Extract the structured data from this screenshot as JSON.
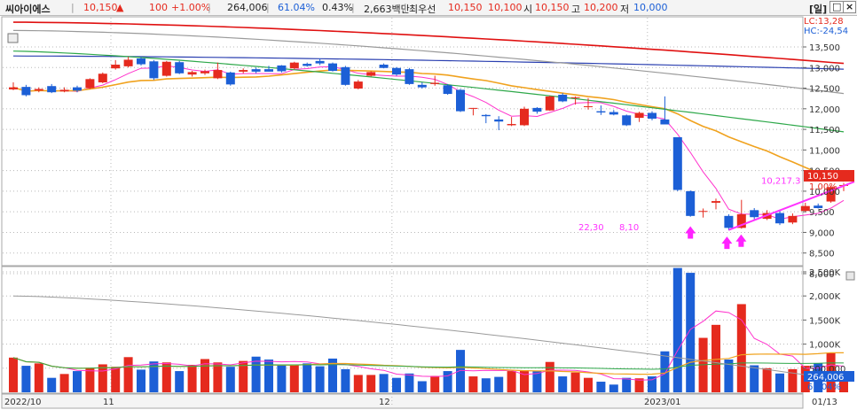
{
  "header": {
    "name": "씨아이에스",
    "price": "10,150",
    "up_mark": "▲",
    "change": "100",
    "change_pct": "+1.00%",
    "volume": "264,006",
    "vol_ratio": "61.04%",
    "turnover": "0.43%",
    "amount": "2,663백만",
    "best_label": "최우선",
    "ask": "10,150",
    "bid": "10,100",
    "open_label": "시",
    "open": "10,150",
    "high_label": "고",
    "high": "10,200",
    "low_label": "저",
    "low": "10,000",
    "period": "[일]",
    "btn_restore": "□",
    "btn_close": "×"
  },
  "colors": {
    "up": "#e52a1e",
    "down": "#1c5fd6",
    "ma5": "#ff33cc",
    "ma20": "#f0a21e",
    "ma60": "#2ea84a",
    "ma120": "#9a9a9a",
    "ma200": "#2a3fb0",
    "ma_red": "#e01010",
    "grid": "#b8b8b8",
    "trend": "#ff33ff"
  },
  "chart_data": {
    "type": "candlestick",
    "price_labels": [
      "13,500",
      "13,000",
      "12,500",
      "12,000",
      "11,500",
      "11,000",
      "10,500",
      "10,000",
      "9,500",
      "9,000",
      "8,500",
      "8,000"
    ],
    "volume_labels": [
      "2,500K",
      "2,000K",
      "1,500K",
      "1,000K",
      "500,000"
    ],
    "x_labels": [
      "2022/10",
      "11",
      "12",
      "2023/01",
      "01/13"
    ],
    "lc_label": "LC:13,28",
    "hc_label": "HC:-24,54",
    "last_price": "10,150",
    "last_change": "1.00%",
    "last_volume": "264,006",
    "last_vol_ratio": "61.04%",
    "trend_label": "10,217.3",
    "low_label_1": "22,30",
    "low_label_2": "8,10",
    "candles": [
      {
        "o": 12470,
        "c": 12520,
        "h": 12640,
        "l": 12450,
        "v": 720000
      },
      {
        "o": 12530,
        "c": 12330,
        "h": 12580,
        "l": 12300,
        "v": 550000
      },
      {
        "o": 12440,
        "c": 12480,
        "h": 12520,
        "l": 12400,
        "v": 600000
      },
      {
        "o": 12550,
        "c": 12400,
        "h": 12600,
        "l": 12380,
        "v": 300000
      },
      {
        "o": 12420,
        "c": 12460,
        "h": 12520,
        "l": 12400,
        "v": 380000
      },
      {
        "o": 12520,
        "c": 12440,
        "h": 12560,
        "l": 12400,
        "v": 440000
      },
      {
        "o": 12500,
        "c": 12720,
        "h": 12740,
        "l": 12480,
        "v": 510000
      },
      {
        "o": 12640,
        "c": 12850,
        "h": 12880,
        "l": 12620,
        "v": 580000
      },
      {
        "o": 12980,
        "c": 13070,
        "h": 13180,
        "l": 12950,
        "v": 530000
      },
      {
        "o": 13030,
        "c": 13190,
        "h": 13260,
        "l": 13000,
        "v": 730000
      },
      {
        "o": 13220,
        "c": 13080,
        "h": 13260,
        "l": 13050,
        "v": 470000
      },
      {
        "o": 13150,
        "c": 12740,
        "h": 13180,
        "l": 12700,
        "v": 640000
      },
      {
        "o": 12800,
        "c": 13140,
        "h": 13160,
        "l": 12780,
        "v": 620000
      },
      {
        "o": 13130,
        "c": 12860,
        "h": 13160,
        "l": 12840,
        "v": 440000
      },
      {
        "o": 12830,
        "c": 12890,
        "h": 12920,
        "l": 12780,
        "v": 570000
      },
      {
        "o": 12860,
        "c": 12910,
        "h": 12950,
        "l": 12820,
        "v": 690000
      },
      {
        "o": 12740,
        "c": 12940,
        "h": 13120,
        "l": 12720,
        "v": 620000
      },
      {
        "o": 12880,
        "c": 12590,
        "h": 12900,
        "l": 12560,
        "v": 530000
      },
      {
        "o": 12900,
        "c": 12940,
        "h": 12980,
        "l": 12860,
        "v": 650000
      },
      {
        "o": 12960,
        "c": 12900,
        "h": 13000,
        "l": 12860,
        "v": 740000
      },
      {
        "o": 12960,
        "c": 12900,
        "h": 13040,
        "l": 12900,
        "v": 680000
      },
      {
        "o": 13050,
        "c": 12910,
        "h": 13060,
        "l": 12880,
        "v": 560000
      },
      {
        "o": 12980,
        "c": 13120,
        "h": 13140,
        "l": 12960,
        "v": 570000
      },
      {
        "o": 13090,
        "c": 13040,
        "h": 13120,
        "l": 13020,
        "v": 600000
      },
      {
        "o": 13160,
        "c": 13100,
        "h": 13220,
        "l": 13060,
        "v": 540000
      },
      {
        "o": 13100,
        "c": 12920,
        "h": 13120,
        "l": 12900,
        "v": 700000
      },
      {
        "o": 13010,
        "c": 12580,
        "h": 13040,
        "l": 12560,
        "v": 480000
      },
      {
        "o": 12490,
        "c": 12660,
        "h": 12700,
        "l": 12470,
        "v": 360000
      },
      {
        "o": 12800,
        "c": 12890,
        "h": 12910,
        "l": 12780,
        "v": 360000
      },
      {
        "o": 13070,
        "c": 12990,
        "h": 13100,
        "l": 12980,
        "v": 380000
      },
      {
        "o": 12990,
        "c": 12830,
        "h": 13010,
        "l": 12800,
        "v": 300000
      },
      {
        "o": 12960,
        "c": 12600,
        "h": 12990,
        "l": 12580,
        "v": 390000
      },
      {
        "o": 12580,
        "c": 12520,
        "h": 12640,
        "l": 12490,
        "v": 230000
      },
      {
        "o": 12600,
        "c": 12630,
        "h": 12800,
        "l": 12560,
        "v": 340000
      },
      {
        "o": 12570,
        "c": 12360,
        "h": 12600,
        "l": 12340,
        "v": 440000
      },
      {
        "o": 12460,
        "c": 11940,
        "h": 12480,
        "l": 11920,
        "v": 880000
      },
      {
        "o": 12020,
        "c": 12020,
        "h": 12020,
        "l": 11840,
        "v": 330000
      },
      {
        "o": 11850,
        "c": 11820,
        "h": 11870,
        "l": 11650,
        "v": 290000
      },
      {
        "o": 11740,
        "c": 11690,
        "h": 11820,
        "l": 11480,
        "v": 320000
      },
      {
        "o": 11600,
        "c": 11630,
        "h": 11800,
        "l": 11580,
        "v": 440000
      },
      {
        "o": 11600,
        "c": 12000,
        "h": 12050,
        "l": 11580,
        "v": 460000
      },
      {
        "o": 12020,
        "c": 11930,
        "h": 12040,
        "l": 11880,
        "v": 440000
      },
      {
        "o": 11960,
        "c": 12300,
        "h": 12320,
        "l": 11950,
        "v": 630000
      },
      {
        "o": 12340,
        "c": 12180,
        "h": 12380,
        "l": 12160,
        "v": 330000
      },
      {
        "o": 12280,
        "c": 12280,
        "h": 12300,
        "l": 12100,
        "v": 410000
      },
      {
        "o": 12040,
        "c": 12060,
        "h": 12260,
        "l": 11980,
        "v": 300000
      },
      {
        "o": 11940,
        "c": 11910,
        "h": 12080,
        "l": 11850,
        "v": 220000
      },
      {
        "o": 11920,
        "c": 11860,
        "h": 11970,
        "l": 11840,
        "v": 160000
      },
      {
        "o": 11840,
        "c": 11600,
        "h": 11860,
        "l": 11580,
        "v": 300000
      },
      {
        "o": 11780,
        "c": 11900,
        "h": 11930,
        "l": 11680,
        "v": 290000
      },
      {
        "o": 11900,
        "c": 11760,
        "h": 11940,
        "l": 11720,
        "v": 330000
      },
      {
        "o": 11740,
        "c": 11620,
        "h": 12300,
        "l": 11620,
        "v": 850000
      },
      {
        "o": 11310,
        "c": 10030,
        "h": 11310,
        "l": 10000,
        "v": 2580000
      },
      {
        "o": 10000,
        "c": 9400,
        "h": 10020,
        "l": 9380,
        "v": 2480000
      },
      {
        "o": 9500,
        "c": 9520,
        "h": 9580,
        "l": 9360,
        "v": 1130000
      },
      {
        "o": 9720,
        "c": 9760,
        "h": 9820,
        "l": 9560,
        "v": 1400000
      },
      {
        "o": 9400,
        "c": 9110,
        "h": 9440,
        "l": 9050,
        "v": 680000
      },
      {
        "o": 9110,
        "c": 9440,
        "h": 9790,
        "l": 9090,
        "v": 1830000
      },
      {
        "o": 9540,
        "c": 9370,
        "h": 9590,
        "l": 9320,
        "v": 560000
      },
      {
        "o": 9330,
        "c": 9470,
        "h": 9540,
        "l": 9300,
        "v": 500000
      },
      {
        "o": 9470,
        "c": 9220,
        "h": 9520,
        "l": 9180,
        "v": 390000
      },
      {
        "o": 9240,
        "c": 9400,
        "h": 9460,
        "l": 9200,
        "v": 480000
      },
      {
        "o": 9520,
        "c": 9640,
        "h": 9720,
        "l": 9500,
        "v": 550000
      },
      {
        "o": 9650,
        "c": 9590,
        "h": 9700,
        "l": 9580,
        "v": 600000
      },
      {
        "o": 9750,
        "c": 10100,
        "h": 10130,
        "l": 9720,
        "v": 820000
      },
      {
        "o": 10150,
        "c": 10150,
        "h": 10200,
        "l": 10000,
        "v": 264006
      }
    ]
  }
}
